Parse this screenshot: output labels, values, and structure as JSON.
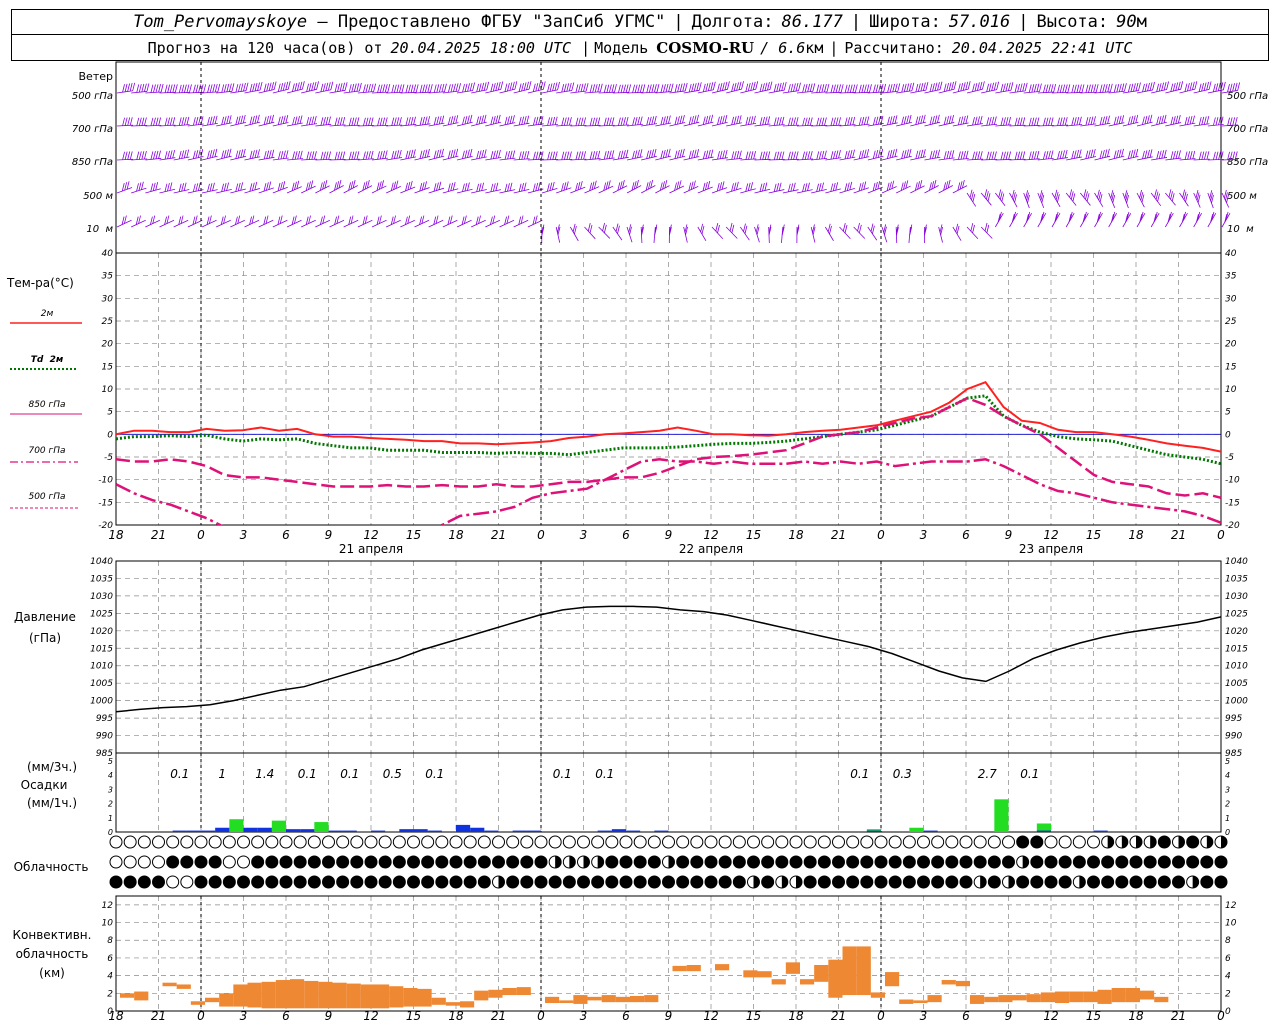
{
  "header": {
    "station": "Tom_Pervomayskoye",
    "dash": " – ",
    "provider": "Предоставлено ФГБУ \"ЗапСиб УГМС\"",
    "lon_label": "Долгота:",
    "lon": "86.177",
    "lat_label": "Широта:",
    "lat": "57.016",
    "alt_label": "Высота:",
    "alt": "90",
    "alt_unit": "м",
    "forecast_label": "Прогноз на 120 часа(ов) от",
    "init_time": "20.04.2025 18:00 UTC",
    "model_label": "Модель",
    "model": "COSMO-RU",
    "resolution": "/ 6.6",
    "res_unit": "км",
    "calc_label": "Рассчитано:",
    "calc_time": "20.04.2025 22:41 UTC",
    "sep": "|"
  },
  "colors": {
    "wind": "#8800dd",
    "t2m": "#ff2020",
    "td2m": "#007700",
    "t850": "#dd1177",
    "t700": "#dd1177",
    "t500": "#dd1177",
    "precip_3h": "#22dd22",
    "precip_1h": "#1133dd",
    "conv_cloud": "#ee8833",
    "zero_line": "#0000cc",
    "grid": "#888888"
  },
  "chart_data": [
    {
      "type": "wind_barbs",
      "panel_label": "Ветер",
      "levels": [
        "500 гПа",
        "700 гПа",
        "850 гПа",
        "500 м",
        "10  м"
      ],
      "note": "wind barbs per level, hourly"
    },
    {
      "type": "line",
      "panel_label": "Тем-ра(°C)",
      "ylim": [
        -20,
        40
      ],
      "yticks": [
        -20,
        -15,
        -10,
        -5,
        0,
        5,
        10,
        15,
        20,
        25,
        30,
        35,
        40
      ],
      "x_hours": [
        0,
        6,
        12,
        18,
        24,
        30,
        36,
        42,
        48,
        54,
        60,
        66,
        72,
        78,
        84,
        90,
        96,
        102,
        108,
        114,
        120
      ],
      "legend": [
        {
          "label": "2м",
          "style": "solid"
        },
        {
          "label": "Td  2м",
          "style": "dotted"
        },
        {
          "label": "850 гПа",
          "style": "dash"
        },
        {
          "label": "700 гПа",
          "style": "dashdot"
        },
        {
          "label": "500 гПа",
          "style": "dashdot2"
        }
      ],
      "series": [
        {
          "name": "2м",
          "values": [
            0,
            0.8,
            0.8,
            0.5,
            0.5,
            1.2,
            0.8,
            0.9,
            1.5,
            0.8,
            1.2,
            0,
            -0.5,
            -0.5,
            -0.8,
            -1,
            -1.2,
            -1.5,
            -1.5,
            -2,
            -2,
            -2.2,
            -2,
            -1.8,
            -1.5,
            -0.8,
            -0.5,
            0,
            0.2,
            0.5,
            0.8,
            1.5,
            0.8,
            0,
            0,
            -0.2,
            -0.3,
            0,
            0.5,
            0.8,
            1,
            1.5,
            2,
            3,
            4,
            5,
            7,
            10,
            11.5,
            6,
            3,
            2.5,
            1,
            0.5,
            0.5,
            0,
            -0.5,
            -1.2,
            -2,
            -2.5,
            -3,
            -3.8
          ]
        },
        {
          "name": "Td  2м",
          "values": [
            -1,
            -0.5,
            -0.5,
            -0.3,
            -0.5,
            -0.2,
            -1,
            -1.5,
            -1,
            -1.2,
            -1,
            -2,
            -2.5,
            -3,
            -3,
            -3.5,
            -3.5,
            -3.5,
            -4,
            -4,
            -4,
            -4.2,
            -4,
            -4.2,
            -4.2,
            -4.5,
            -4,
            -3.5,
            -3,
            -3,
            -3,
            -2.8,
            -2.5,
            -2.2,
            -2,
            -2,
            -1.8,
            -1.5,
            -1,
            -0.5,
            0,
            0.5,
            1,
            2,
            3,
            4,
            6,
            8,
            8.5,
            4,
            2,
            0.5,
            -0.5,
            -1,
            -1.2,
            -1.5,
            -2.5,
            -3.5,
            -4.5,
            -5,
            -5.5,
            -6.5
          ]
        },
        {
          "name": "850 гПа",
          "values": [
            -5.5,
            -6,
            -6,
            -5.5,
            -6,
            -7,
            -9,
            -9.5,
            -9.5,
            -10,
            -10.5,
            -11,
            -11.5,
            -11.5,
            -11.5,
            -11.2,
            -11.5,
            -11.5,
            -11.2,
            -11.5,
            -11.5,
            -11,
            -11.5,
            -11.5,
            -11,
            -10.5,
            -10.5,
            -10,
            -9.5,
            -9.5,
            -8.5,
            -7,
            -5.5,
            -5,
            -4.8,
            -4.5,
            -4,
            -3.5,
            -2,
            -0.5,
            0,
            0.5,
            1.5,
            2.5,
            3.5,
            4,
            6,
            8,
            6.5,
            4,
            2,
            0,
            -3,
            -6,
            -9,
            -10.5,
            -11,
            -11.5,
            -13,
            -13.5,
            -13,
            -14
          ]
        },
        {
          "name": "700 гПа",
          "values": [
            -11,
            -13,
            -14.5,
            -15.5,
            -17,
            -18.5,
            -20.5,
            -22,
            -23,
            -24,
            -25,
            -26,
            -27,
            -27,
            -26,
            -25,
            -24,
            -22,
            -20,
            -18,
            -17.5,
            -17,
            -16,
            -14,
            -13,
            -12.5,
            -12,
            -10,
            -8,
            -6,
            -5.5,
            -6,
            -6,
            -6.5,
            -6,
            -6.5,
            -6.5,
            -6.5,
            -6,
            -6.5,
            -6,
            -6.5,
            -6,
            -7,
            -6.5,
            -6,
            -6,
            -6,
            -5.5,
            -7,
            -9,
            -11,
            -12.5,
            -13,
            -14,
            -15,
            -15.5,
            -16,
            -16.5,
            -17,
            -18,
            -19.5
          ]
        },
        {
          "name": "500 гПа",
          "values": []
        }
      ]
    },
    {
      "type": "line",
      "panel_label": "Давление",
      "unit_label": "(гПа)",
      "ylim": [
        985,
        1040
      ],
      "yticks": [
        985,
        990,
        995,
        1000,
        1005,
        1010,
        1015,
        1020,
        1025,
        1030,
        1035,
        1040
      ],
      "series": [
        {
          "name": "Давление",
          "values": [
            996.8,
            997.5,
            998,
            998.3,
            998.8,
            1000,
            1001.5,
            1003,
            1004,
            1006,
            1008,
            1010,
            1012,
            1014.5,
            1016.5,
            1018.5,
            1020.5,
            1022.5,
            1024.5,
            1026,
            1026.8,
            1027,
            1027,
            1026.8,
            1026,
            1025.5,
            1024.5,
            1023,
            1021.5,
            1020,
            1018.5,
            1017,
            1015.5,
            1013.5,
            1011,
            1008.5,
            1006.5,
            1005.5,
            1008.5,
            1012,
            1014.5,
            1016.5,
            1018.2,
            1019.5,
            1020.5,
            1021.5,
            1022.5,
            1024
          ]
        }
      ]
    },
    {
      "type": "bar",
      "panel_label": "Осадки",
      "units_top": "(мм/3ч.)",
      "units_bottom": "(мм/1ч.)",
      "ylim": [
        0,
        5
      ],
      "yticks": [
        0,
        1,
        2,
        3,
        4,
        5
      ],
      "totals": [
        {
          "hour": 6,
          "text": "0.1"
        },
        {
          "hour": 9,
          "text": "1"
        },
        {
          "hour": 12,
          "text": "1.4"
        },
        {
          "hour": 15,
          "text": "0.1"
        },
        {
          "hour": 18,
          "text": "0.1"
        },
        {
          "hour": 21,
          "text": "0.5"
        },
        {
          "hour": 24,
          "text": "0.1"
        },
        {
          "hour": 33,
          "text": "0.1"
        },
        {
          "hour": 36,
          "text": "0.1"
        },
        {
          "hour": 54,
          "text": "0.1"
        },
        {
          "hour": 57,
          "text": "0.3"
        },
        {
          "hour": 63,
          "text": "2.7"
        },
        {
          "hour": 66,
          "text": "0.1"
        }
      ],
      "series": [
        {
          "name": "3h",
          "points": [
            [
              9,
              0.9
            ],
            [
              12,
              0.8
            ],
            [
              15,
              0.7
            ],
            [
              54,
              0.2
            ],
            [
              57,
              0.3
            ],
            [
              63,
              2.3
            ],
            [
              66,
              0.6
            ]
          ]
        },
        {
          "name": "1h",
          "points": [
            [
              5,
              0.1
            ],
            [
              6,
              0.1
            ],
            [
              7,
              0.1
            ],
            [
              8,
              0.3
            ],
            [
              10,
              0.3
            ],
            [
              11,
              0.3
            ],
            [
              13,
              0.2
            ],
            [
              14,
              0.2
            ],
            [
              16,
              0.1
            ],
            [
              17,
              0.1
            ],
            [
              19,
              0.1
            ],
            [
              21,
              0.2
            ],
            [
              22,
              0.2
            ],
            [
              23,
              0.1
            ],
            [
              25,
              0.5
            ],
            [
              26,
              0.3
            ],
            [
              27,
              0.1
            ],
            [
              29,
              0.1
            ],
            [
              30,
              0.1
            ],
            [
              35,
              0.1
            ],
            [
              36,
              0.2
            ],
            [
              37,
              0.1
            ],
            [
              39,
              0.1
            ],
            [
              54,
              0.1
            ],
            [
              58,
              0.1
            ],
            [
              66,
              0.1
            ],
            [
              70,
              0.1
            ]
          ]
        }
      ]
    },
    {
      "type": "symbols",
      "panel_label": "Облачность",
      "rows": [
        "ooooooooooooooooooooooooooooooooooooooooooooooooooooooooooooooooHHooooQQQQHQHQQHHHHHHHHHHHHHHHHHQooQoooooQooooooooooooooooooooooo",
        "ooooHHHHooHHHHHHHHHHHHHHHHHHHHHQQQQHHHHQHHHHHHHHHHHHHHHHHHHHHHHHQHHHHHHHHHHHHHHQQQQQQQQHQHHoooHoooooHoooooo",
        "HHHHooHHHHHHHHHHHHHHHHHHHHHQHHHHHHHHHHHHHHHHHQHQQHHHHHHHHHHHHQHQHHHHQHHHHHHHQHHHHHHHHHHHHHHHHQHHHHHHHHHHHHHHQoQHHH"
      ]
    },
    {
      "type": "bar",
      "panel_label": "Конвективн.",
      "panel_label2": "облачность",
      "unit_label": "(км)",
      "ylim": [
        0,
        13
      ],
      "yticks": [
        0,
        2,
        4,
        6,
        8,
        10,
        12
      ],
      "ranges": [
        [
          0,
          1.5,
          2
        ],
        [
          1,
          1.2,
          2.2
        ],
        [
          3,
          2.8,
          3.2
        ],
        [
          4,
          2.5,
          3
        ],
        [
          5,
          0.7,
          1.1
        ],
        [
          6,
          1,
          1.5
        ],
        [
          7,
          0.5,
          2
        ],
        [
          8,
          0.5,
          3
        ],
        [
          9,
          0.4,
          3.2
        ],
        [
          10,
          0.3,
          3.3
        ],
        [
          11,
          0.3,
          3.5
        ],
        [
          12,
          0.3,
          3.6
        ],
        [
          13,
          0.3,
          3.4
        ],
        [
          14,
          0.3,
          3.3
        ],
        [
          15,
          0.3,
          3.2
        ],
        [
          16,
          0.3,
          3.1
        ],
        [
          17,
          0.3,
          3
        ],
        [
          18,
          0.3,
          3
        ],
        [
          19,
          0.4,
          2.8
        ],
        [
          20,
          0.5,
          2.6
        ],
        [
          21,
          0.5,
          2.5
        ],
        [
          22,
          0.7,
          1.5
        ],
        [
          23,
          0.6,
          1
        ],
        [
          24,
          0.4,
          1.1
        ],
        [
          25,
          1.2,
          2.3
        ],
        [
          26,
          1.5,
          2.4
        ],
        [
          27,
          1.8,
          2.6
        ],
        [
          28,
          1.8,
          2.7
        ],
        [
          30,
          0.9,
          1.6
        ],
        [
          31,
          0.9,
          1.2
        ],
        [
          32,
          0.8,
          1.8
        ],
        [
          33,
          1.2,
          1.6
        ],
        [
          34,
          1,
          1.8
        ],
        [
          35,
          1,
          1.6
        ],
        [
          36,
          1,
          1.7
        ],
        [
          37,
          1,
          1.8
        ],
        [
          39,
          4.5,
          5.1
        ],
        [
          40,
          4.5,
          5.2
        ],
        [
          42,
          4.6,
          5.3
        ],
        [
          44,
          3.8,
          4.6
        ],
        [
          45,
          3.8,
          4.5
        ],
        [
          46,
          3,
          3.6
        ],
        [
          47,
          4.2,
          5.5
        ],
        [
          48,
          3,
          3.6
        ],
        [
          49,
          3.3,
          5.2
        ],
        [
          50,
          1.5,
          5.8
        ],
        [
          51,
          1.8,
          7.3
        ],
        [
          52,
          1.8,
          7.3
        ],
        [
          53,
          1.5,
          2.1
        ],
        [
          54,
          2.8,
          4.4
        ],
        [
          55,
          0.8,
          1.3
        ],
        [
          56,
          0.9,
          1.2
        ],
        [
          57,
          1,
          1.8
        ],
        [
          58,
          3,
          3.5
        ],
        [
          59,
          2.8,
          3.4
        ],
        [
          60,
          0.8,
          1.8
        ],
        [
          61,
          1,
          1.6
        ],
        [
          62,
          1,
          1.8
        ],
        [
          63,
          1.2,
          1.8
        ],
        [
          64,
          1,
          1.9
        ],
        [
          65,
          1,
          2.1
        ],
        [
          66,
          0.9,
          2.2
        ],
        [
          67,
          1,
          2.2
        ],
        [
          68,
          1,
          2.2
        ],
        [
          69,
          0.8,
          2.4
        ],
        [
          70,
          1,
          2.6
        ],
        [
          71,
          1,
          2.6
        ],
        [
          72,
          1.3,
          2.3
        ],
        [
          73,
          1,
          1.6
        ]
      ]
    }
  ],
  "axis": {
    "hour_labels": [
      "18",
      "21",
      "0",
      "3",
      "6",
      "9",
      "12",
      "15",
      "18",
      "21",
      "0",
      "3",
      "6",
      "9",
      "12",
      "15",
      "18",
      "21",
      "0",
      "3",
      "6",
      "9",
      "12",
      "15",
      "18",
      "21",
      "0"
    ],
    "day_labels": [
      "21 апреля",
      "22 апреля",
      "23 апреля"
    ]
  }
}
